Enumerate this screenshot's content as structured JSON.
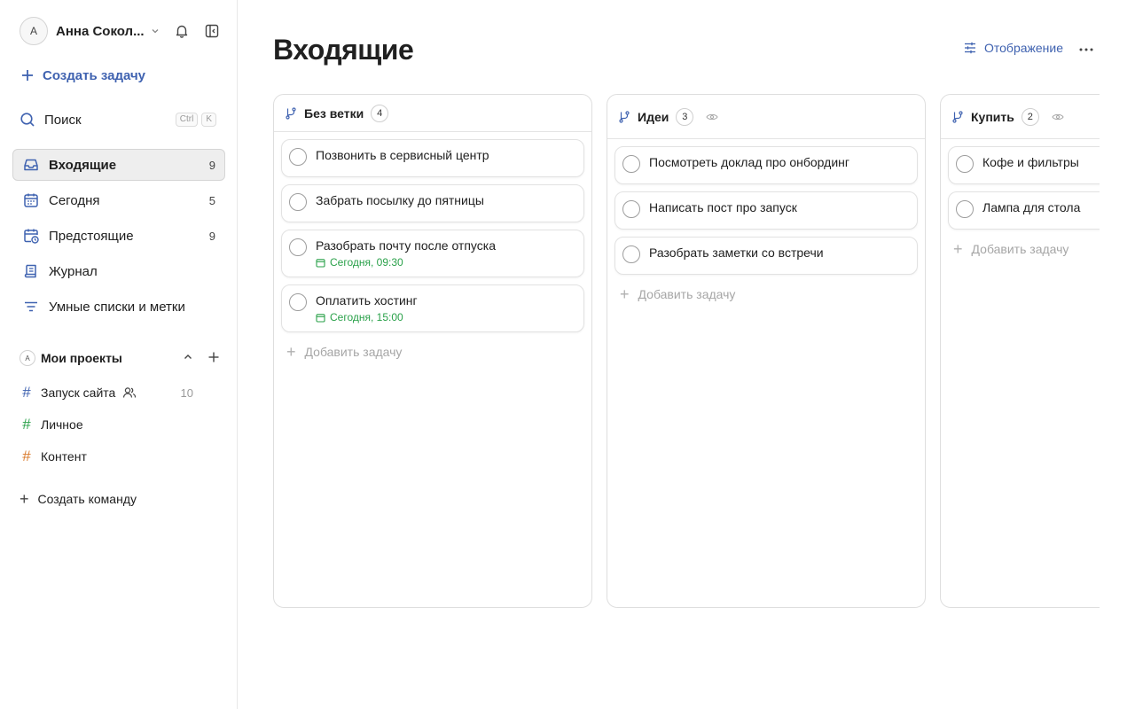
{
  "user": {
    "initial": "А",
    "name": "Анна Сокол..."
  },
  "sidebar": {
    "create_task": "Создать задачу",
    "search": {
      "label": "Поиск",
      "kbd1": "Ctrl",
      "kbd2": "K"
    },
    "nav": [
      {
        "label": "Входящие",
        "count": "9",
        "icon": "inbox-icon",
        "active": true
      },
      {
        "label": "Сегодня",
        "count": "5",
        "icon": "calendar-icon"
      },
      {
        "label": "Предстоящие",
        "count": "9",
        "icon": "calendar-clock-icon"
      },
      {
        "label": "Журнал",
        "count": "",
        "icon": "journal-icon"
      },
      {
        "label": "Умные списки и метки",
        "count": "",
        "icon": "filter-icon"
      }
    ],
    "projects_header": {
      "avatar": "А",
      "label": "Мои проекты"
    },
    "projects": [
      {
        "label": "Запуск сайта",
        "count": "10",
        "color": "#3f62b0"
      },
      {
        "label": "Личное",
        "count": "",
        "color": "#2aa14a"
      },
      {
        "label": "Контент",
        "count": "",
        "color": "#d97a2b"
      }
    ],
    "create_team": "Создать команду"
  },
  "main": {
    "title": "Входящие",
    "view_label": "Отображение",
    "add_task_label": "Добавить задачу",
    "columns": [
      {
        "title": "Без ветки",
        "count": "4",
        "tasks": [
          {
            "text": "Позвонить в сервисный центр",
            "due": ""
          },
          {
            "text": "Забрать посылку до пятницы",
            "due": ""
          },
          {
            "text": "Разобрать почту после отпуска",
            "due": "Сегодня, 09:30"
          },
          {
            "text": "Оплатить хостинг",
            "due": "Сегодня, 15:00"
          }
        ]
      },
      {
        "title": "Идеи",
        "count": "3",
        "tasks": [
          {
            "text": "Посмотреть доклад про онбординг",
            "due": ""
          },
          {
            "text": "Написать пост про запуск",
            "due": ""
          },
          {
            "text": "Разобрать заметки со встречи",
            "due": ""
          }
        ]
      },
      {
        "title": "Купить",
        "count": "2",
        "tasks": [
          {
            "text": "Кофе и фильтры",
            "due": ""
          },
          {
            "text": "Лампа для стола",
            "due": ""
          }
        ]
      }
    ]
  },
  "colors": {
    "accent": "#3f62b0",
    "due_green": "#2aa14a",
    "border": "#dedede"
  }
}
